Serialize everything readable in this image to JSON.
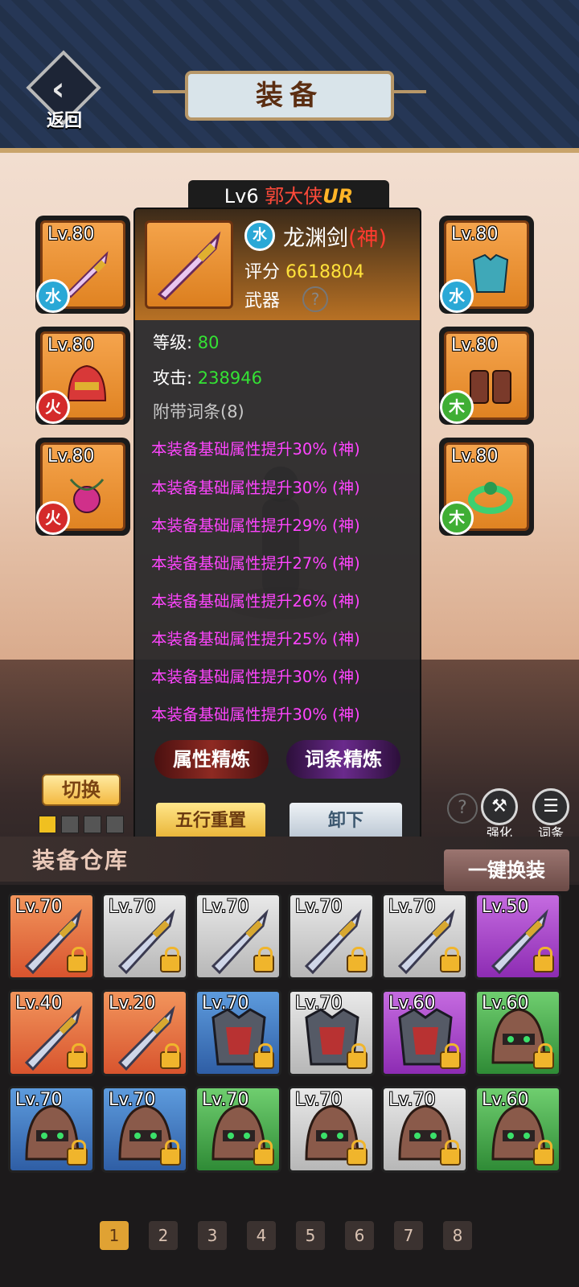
{
  "header": {
    "back_label": "返回",
    "title": "装备"
  },
  "hero": {
    "level": "Lv6",
    "name": "郭大侠",
    "rarity": "UR"
  },
  "slots": [
    {
      "level": "Lv.80",
      "element": "水",
      "element_color": "#2aa8d6",
      "icon": "sword-icon"
    },
    {
      "level": "Lv.80",
      "element": "火",
      "element_color": "#d42a2a",
      "icon": "helmet-icon"
    },
    {
      "level": "Lv.80",
      "element": "火",
      "element_color": "#d42a2a",
      "icon": "necklace-icon"
    },
    {
      "level": "Lv.80",
      "element": "水",
      "element_color": "#2aa8d6",
      "icon": "armor-icon"
    },
    {
      "level": "Lv.80",
      "element": "木",
      "element_color": "#3fae34",
      "icon": "boots-icon"
    },
    {
      "level": "Lv.80",
      "element": "木",
      "element_color": "#3fae34",
      "icon": "ring-icon"
    }
  ],
  "panel": {
    "element": "水",
    "name": "龙渊剑",
    "grade": "(神)",
    "score_label": "评分",
    "score": "6618804",
    "type": "武器",
    "help": "?",
    "level_label": "等级:",
    "level": "80",
    "attack_label": "攻击:",
    "attack": "238946",
    "affix_title": "附带词条(8)",
    "affixes": [
      "本装备基础属性提升30% (神)",
      "本装备基础属性提升30% (神)",
      "本装备基础属性提升29% (神)",
      "本装备基础属性提升27% (神)",
      "本装备基础属性提升26% (神)",
      "本装备基础属性提升25% (神)",
      "本装备基础属性提升30% (神)",
      "本装备基础属性提升30% (神)"
    ],
    "refine_attr": "属性精炼",
    "refine_affix": "词条精炼",
    "reset_label": "五行重置",
    "unequip_label": "卸下"
  },
  "controls": {
    "switch_label": "切换",
    "strengthen_label": "强化",
    "affix_label": "词条",
    "help": "?"
  },
  "warehouse": {
    "title": "装备仓库",
    "oneclick_label": "一键换装"
  },
  "inventory": [
    {
      "level": "Lv.70",
      "rarity": "orange",
      "icon": "sword-icon"
    },
    {
      "level": "Lv.70",
      "rarity": "gray",
      "icon": "sword-icon"
    },
    {
      "level": "Lv.70",
      "rarity": "gray",
      "icon": "sword-icon"
    },
    {
      "level": "Lv.70",
      "rarity": "gray",
      "icon": "sword-icon"
    },
    {
      "level": "Lv.70",
      "rarity": "gray",
      "icon": "sword-icon"
    },
    {
      "level": "Lv.50",
      "rarity": "purple",
      "icon": "sword-icon"
    },
    {
      "level": "Lv.40",
      "rarity": "orange",
      "icon": "sword-icon"
    },
    {
      "level": "Lv.20",
      "rarity": "orange",
      "icon": "sword-icon"
    },
    {
      "level": "Lv.70",
      "rarity": "blue",
      "icon": "armor-icon"
    },
    {
      "level": "Lv.70",
      "rarity": "gray",
      "icon": "armor-icon"
    },
    {
      "level": "Lv.60",
      "rarity": "purple",
      "icon": "armor-icon"
    },
    {
      "level": "Lv.60",
      "rarity": "green",
      "icon": "helmet-icon"
    },
    {
      "level": "Lv.70",
      "rarity": "blue",
      "icon": "helmet-icon"
    },
    {
      "level": "Lv.70",
      "rarity": "blue",
      "icon": "helmet-icon"
    },
    {
      "level": "Lv.70",
      "rarity": "green",
      "icon": "helmet-icon"
    },
    {
      "level": "Lv.70",
      "rarity": "gray",
      "icon": "helmet-icon"
    },
    {
      "level": "Lv.70",
      "rarity": "gray",
      "icon": "helmet-icon"
    },
    {
      "level": "Lv.60",
      "rarity": "green",
      "icon": "helmet-icon"
    }
  ],
  "pagination": [
    "1",
    "2",
    "3",
    "4",
    "5",
    "6",
    "7",
    "8"
  ],
  "active_page": "1"
}
